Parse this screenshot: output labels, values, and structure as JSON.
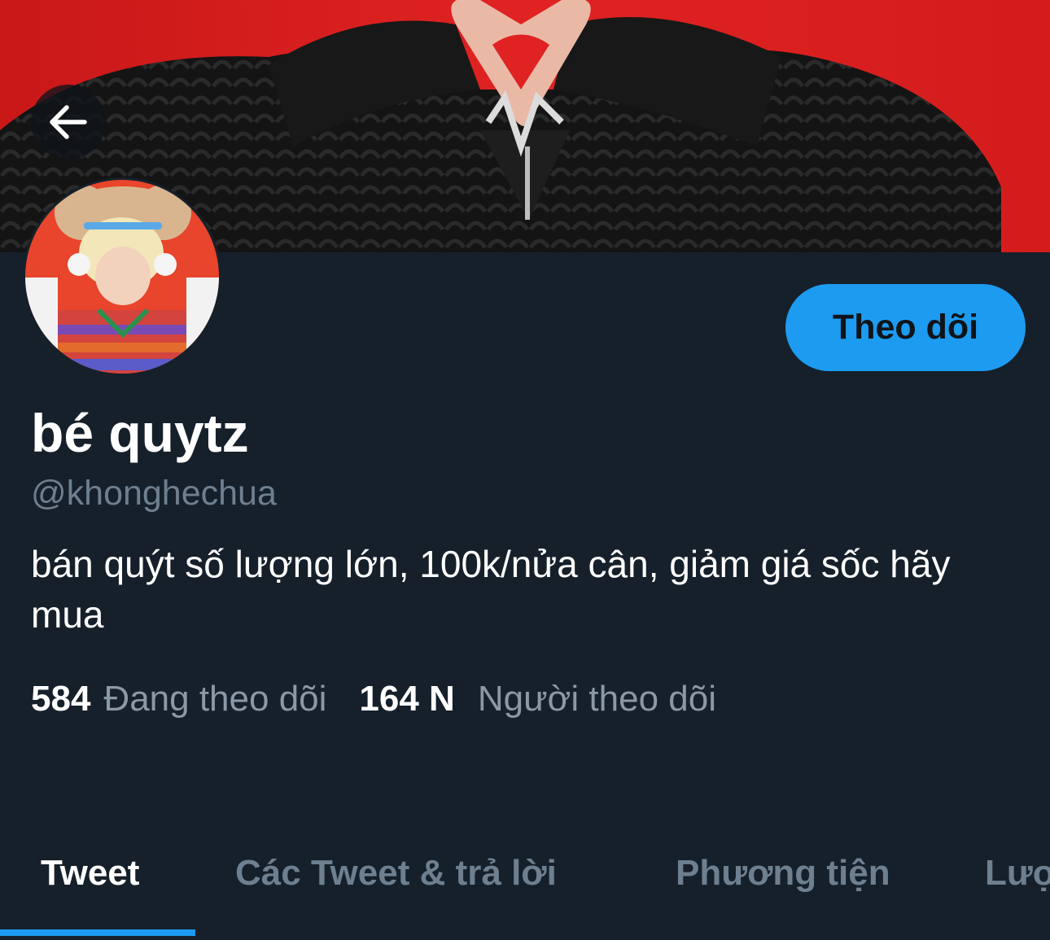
{
  "header": {
    "back_icon": "arrow-left-icon"
  },
  "profile": {
    "display_name": "bé quytz",
    "handle": "@khonghechua",
    "bio": "bán quýt số lượng lớn, 100k/nửa cân, giảm giá sốc hãy mua",
    "follow_button_label": "Theo dõi"
  },
  "stats": {
    "following_count": "584",
    "following_label": "Đang theo dõi",
    "followers_count": "164 N",
    "followers_label": "Người theo dõi"
  },
  "tabs": [
    {
      "label": "Tweet",
      "active": true
    },
    {
      "label": "Các Tweet & trả lời",
      "active": false
    },
    {
      "label": "Phương tiện",
      "active": false
    },
    {
      "label": "Lượ",
      "active": false
    }
  ],
  "colors": {
    "background": "#15202b",
    "accent": "#1d9bf0",
    "muted_text": "#6e7f8f",
    "banner_red": "#d81f1f"
  }
}
